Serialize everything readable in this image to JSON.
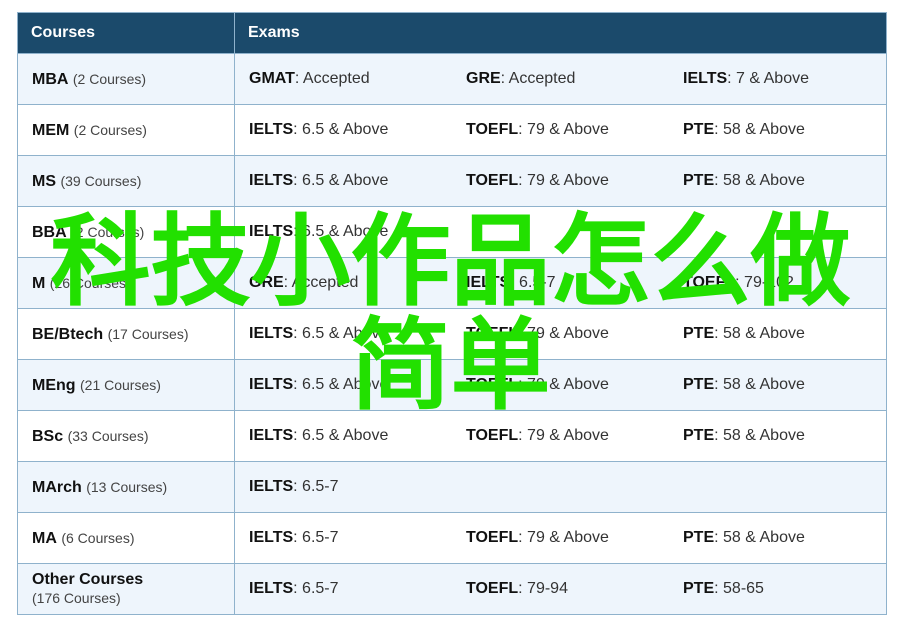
{
  "header": {
    "courses_label": "Courses",
    "exams_label": "Exams"
  },
  "rows": [
    {
      "name": "MBA",
      "count": "(2 Courses)",
      "exams": [
        {
          "name": "GMAT",
          "score": ": Accepted"
        },
        {
          "name": "GRE",
          "score": ": Accepted"
        },
        {
          "name": "IELTS",
          "score": ": 7 & Above"
        }
      ]
    },
    {
      "name": "MEM",
      "count": "(2 Courses)",
      "exams": [
        {
          "name": "IELTS",
          "score": ": 6.5 & Above"
        },
        {
          "name": "TOEFL",
          "score": ": 79 & Above"
        },
        {
          "name": "PTE",
          "score": ": 58 & Above"
        }
      ]
    },
    {
      "name": "MS",
      "count": "(39 Courses)",
      "exams": [
        {
          "name": "IELTS",
          "score": ": 6.5 & Above"
        },
        {
          "name": "TOEFL",
          "score": ": 79 & Above"
        },
        {
          "name": "PTE",
          "score": ": 58 & Above"
        }
      ]
    },
    {
      "name": "BBA",
      "count": "(2 Courses)",
      "exams": [
        {
          "name": "IELTS",
          "score": ": 6.5 & Above"
        },
        {
          "name": "",
          "score": ""
        },
        {
          "name": "",
          "score": ""
        }
      ]
    },
    {
      "name": "M",
      "count": "(26 Courses)",
      "exams": [
        {
          "name": "GRE",
          "score": ": Accepted"
        },
        {
          "name": "IELTS",
          "score": ": 6.5-7"
        },
        {
          "name": "TOEFL",
          "score": ": 79-102"
        }
      ]
    },
    {
      "name": "BE/Btech",
      "count": "(17 Courses)",
      "exams": [
        {
          "name": "IELTS",
          "score": ": 6.5 & Above"
        },
        {
          "name": "TOEFL",
          "score": ": 79 & Above"
        },
        {
          "name": "PTE",
          "score": ": 58 & Above"
        }
      ]
    },
    {
      "name": "MEng",
      "count": "(21 Courses)",
      "exams": [
        {
          "name": "IELTS",
          "score": ": 6.5 & Above"
        },
        {
          "name": "TOEFL",
          "score": ": 79 & Above"
        },
        {
          "name": "PTE",
          "score": ": 58 & Above"
        }
      ]
    },
    {
      "name": "BSc",
      "count": "(33 Courses)",
      "exams": [
        {
          "name": "IELTS",
          "score": ": 6.5 & Above"
        },
        {
          "name": "TOEFL",
          "score": ": 79 & Above"
        },
        {
          "name": "PTE",
          "score": ": 58 & Above"
        }
      ]
    },
    {
      "name": "MArch",
      "count": "(13 Courses)",
      "exams": [
        {
          "name": "IELTS",
          "score": ": 6.5-7"
        },
        {
          "name": "",
          "score": ""
        },
        {
          "name": "",
          "score": ""
        }
      ]
    },
    {
      "name": "MA",
      "count": "(6 Courses)",
      "exams": [
        {
          "name": "IELTS",
          "score": ": 6.5-7"
        },
        {
          "name": "TOEFL",
          "score": ": 79 & Above"
        },
        {
          "name": "PTE",
          "score": ": 58 & Above"
        }
      ]
    },
    {
      "name": "Other Courses",
      "count": "(176 Courses)",
      "exams": [
        {
          "name": "IELTS",
          "score": ": 6.5-7"
        },
        {
          "name": "TOEFL",
          "score": ": 79-94"
        },
        {
          "name": "PTE",
          "score": ": 58-65"
        }
      ]
    }
  ],
  "watermark": {
    "line1": "科技小作品怎么做",
    "line2": "简单",
    "color": "#22e000"
  },
  "colors": {
    "header_bg": "#1b4a6b",
    "row_odd": "#eef5fc",
    "row_even": "#ffffff",
    "border": "#8fb2cc"
  }
}
